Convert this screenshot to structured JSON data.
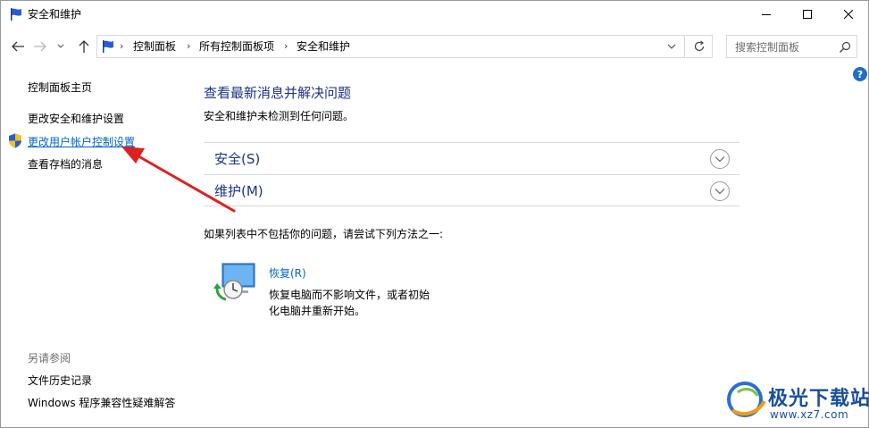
{
  "window": {
    "title": "安全和维护"
  },
  "address_bar": {
    "crumbs": [
      "控制面板",
      "所有控制面板项",
      "安全和维护"
    ]
  },
  "search": {
    "placeholder": "搜索控制面板"
  },
  "help": {
    "glyph": "?"
  },
  "left_pane": {
    "home_link": "控制面板主页",
    "links": [
      "更改安全和维护设置",
      "更改用户帐户控制设置",
      "查看存档的消息"
    ],
    "see_also_heading": "另请参阅",
    "see_also": [
      "文件历史记录",
      "Windows 程序兼容性疑难解答"
    ]
  },
  "main": {
    "title": "查看最新消息并解决问题",
    "status": "安全和维护未检测到任何问题。",
    "sections": [
      {
        "label": "安全(S)"
      },
      {
        "label": "维护(M)"
      }
    ],
    "hint": "如果列表中不包括你的问题，请尝试下列方法之一:",
    "recovery": {
      "link": "恢复(R)",
      "description": "恢复电脑而不影响文件，或者初始化电脑并重新开始。"
    }
  },
  "watermark": {
    "brand": "极光下载站",
    "url": "www.xz7.com"
  },
  "colors": {
    "link_blue": "#0066cc",
    "heading_blue": "#1e3287",
    "annotation_red": "#e02020"
  }
}
